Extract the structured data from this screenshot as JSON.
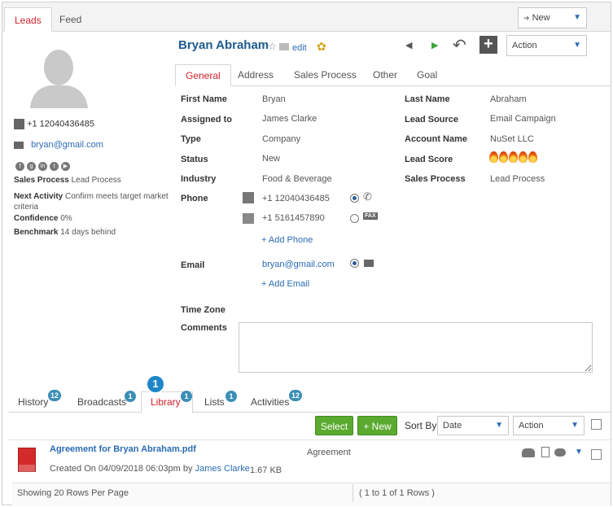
{
  "top_tabs": [
    {
      "label": "Leads",
      "active": true
    },
    {
      "label": "Feed",
      "active": false
    }
  ],
  "new_select": {
    "label": "New"
  },
  "contact": {
    "name": "Bryan Abraham",
    "edit_label": "edit",
    "phone": "+1 12040436485",
    "email": "bryan@gmail.com"
  },
  "action_select": {
    "label": "Action"
  },
  "sidebar": {
    "sales_process_label": "Sales Process",
    "sales_process_value": "Lead Process",
    "next_activity_label": "Next Activity",
    "next_activity_value_line1": "Confirm meets target market",
    "next_activity_value_line2": "criteria",
    "confidence_label": "Confidence",
    "confidence_value": "0%",
    "benchmark_label": "Benchmark",
    "benchmark_value": "14 days behind"
  },
  "content_tabs": [
    {
      "label": "General",
      "active": true
    },
    {
      "label": "Address",
      "active": false
    },
    {
      "label": "Sales Process",
      "active": false
    },
    {
      "label": "Other",
      "active": false
    },
    {
      "label": "Goal",
      "active": false
    }
  ],
  "fields_left": [
    {
      "label": "First Name",
      "value": "Bryan"
    },
    {
      "label": "Assigned to",
      "value": "James Clarke"
    },
    {
      "label": "Type",
      "value": "Company"
    },
    {
      "label": "Status",
      "value": "New"
    },
    {
      "label": "Industry",
      "value": "Food & Beverage"
    }
  ],
  "fields_right": [
    {
      "label": "Last Name",
      "value": "Abraham"
    },
    {
      "label": "Lead Source",
      "value": "Email Campaign"
    },
    {
      "label": "Account Name",
      "value": "NuSet LLC"
    },
    {
      "label": "Lead Score",
      "value": ""
    },
    {
      "label": "Sales Process",
      "value": "Lead Process"
    }
  ],
  "lead_score_flames": 5,
  "phone_section": {
    "label": "Phone",
    "numbers": [
      "+1 12040436485",
      "+1 5161457890"
    ],
    "fax_badge": "FAX",
    "add_label": "+ Add Phone"
  },
  "email_section": {
    "label": "Email",
    "value": "bryan@gmail.com",
    "add_label": "+ Add Email"
  },
  "time_zone_label": "Time Zone",
  "comments_label": "Comments",
  "bottom_tabs": [
    {
      "label": "History",
      "count": "12"
    },
    {
      "label": "Broadcasts",
      "count": "1"
    },
    {
      "label": "Library",
      "count": "1",
      "active": true
    },
    {
      "label": "Lists",
      "count": "1"
    },
    {
      "label": "Activities",
      "count": "12"
    }
  ],
  "step_marker": "1",
  "toolbar": {
    "select_label": "Select",
    "new_label": "+ New",
    "sort_by_label": "Sort By",
    "sort_value": "Date",
    "action_value": "Action"
  },
  "library_item": {
    "title": "Agreement for Bryan Abraham.pdf",
    "category": "Agreement",
    "created_prefix": "Created On 04/09/2018 06:03pm by",
    "created_by": "James Clarke",
    "size": "1.67 KB"
  },
  "footer": {
    "rows_per_page": "Showing 20 Rows Per Page",
    "range": "( 1 to 1 of 1 Rows )"
  },
  "colors": {
    "accent_red": "#d0202a",
    "link_blue": "#2b6cb3",
    "green": "#5aaa2f",
    "badge_blue": "#3b8fb6"
  }
}
